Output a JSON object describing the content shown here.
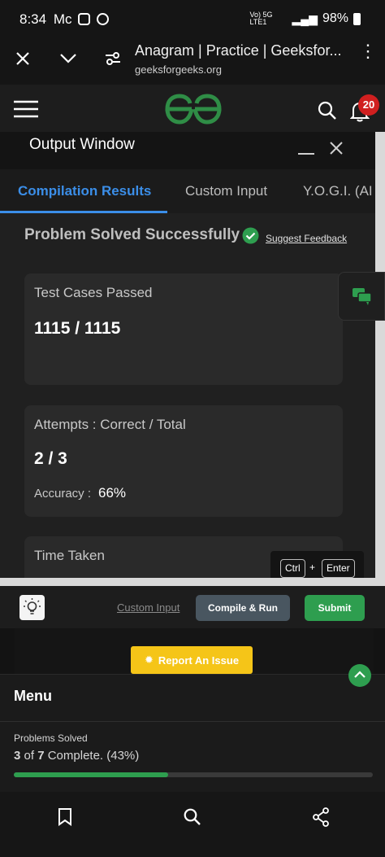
{
  "status_bar": {
    "time": "8:34",
    "carrier_glyph": "Mc",
    "network": "Vo) 5G LTE1",
    "battery": "98%"
  },
  "browser": {
    "page_title": "Anagram | Practice | Geeksfor...",
    "url": "geeksforgeeks.org"
  },
  "site_header": {
    "logo": "GfG",
    "notification_count": "20"
  },
  "output_window": {
    "title": "Output Window",
    "tabs": [
      "Compilation Results",
      "Custom Input",
      "Y.O.G.I. (AI B"
    ],
    "status": "Problem Solved Successfully",
    "suggest_feedback": "Suggest Feedback",
    "test_cases_label": "Test Cases Passed",
    "test_cases_value": "1115 / 1115",
    "attempts_label": "Attempts : Correct / Total",
    "attempts_value": "2 / 3",
    "accuracy_label": "Accuracy :",
    "accuracy_value": "66%",
    "time_label": "Time Taken"
  },
  "shortcut": {
    "ctrl": "Ctrl",
    "plus": "+",
    "enter": "Enter"
  },
  "toolbar": {
    "custom_input": "Custom Input",
    "compile_run": "Compile & Run",
    "submit": "Submit"
  },
  "report_issue": "Report An Issue",
  "menu": {
    "title": "Menu",
    "problems_solved_label": "Problems Solved",
    "solved": "3",
    "of_text": "of",
    "total": "7",
    "complete_text": "Complete. (43%)",
    "progress_fraction": 0.43
  },
  "colors": {
    "accent_blue": "#3b8ee8",
    "success_green": "#2e9e4f",
    "report_yellow": "#f5c518",
    "progress_green": "#2e9e4f"
  }
}
